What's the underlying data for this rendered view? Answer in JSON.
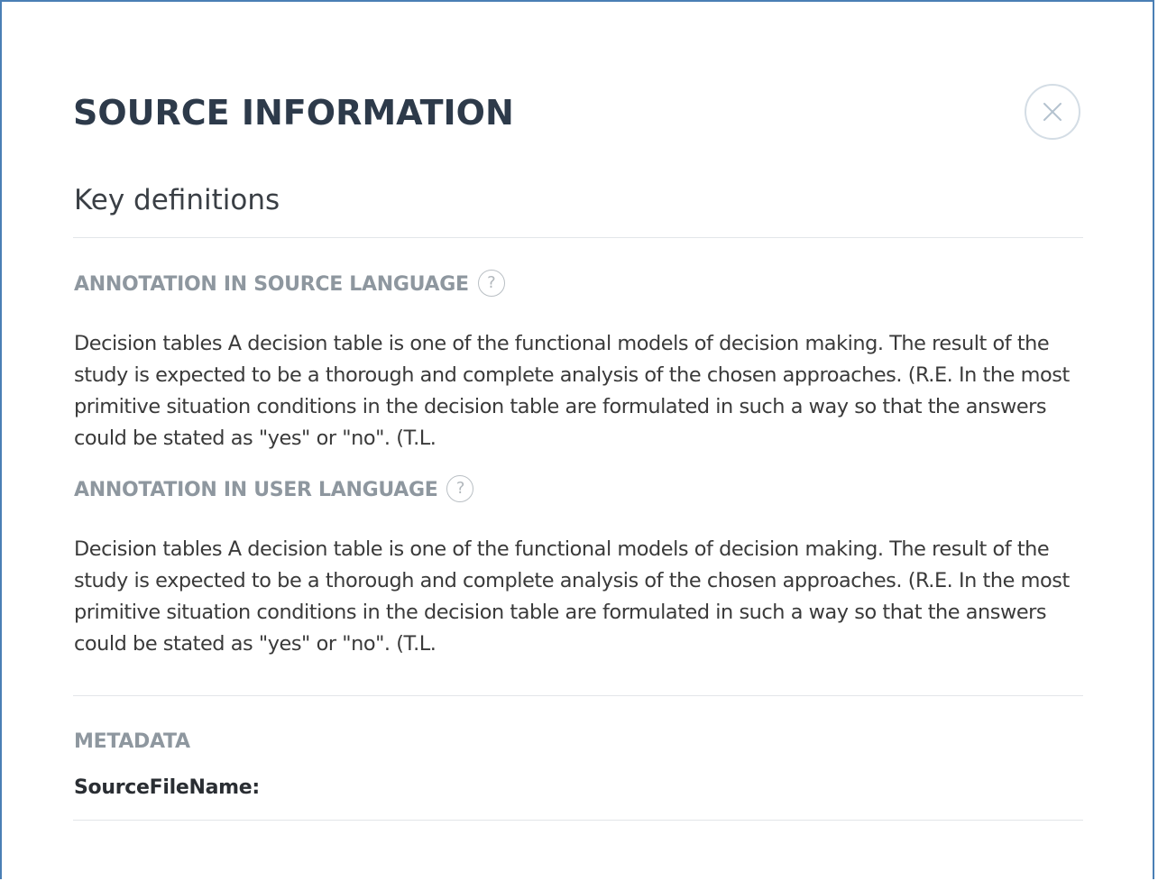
{
  "modal": {
    "title": "SOURCE INFORMATION",
    "close_icon": "close-icon",
    "subtitle": "Key definitions",
    "annotation_source": {
      "label": "ANNOTATION IN SOURCE LANGUAGE",
      "help_symbol": "?",
      "text": "Decision tables A decision table is one of the functional models of decision making. The result of the study is expected to be a thorough and complete analysis of the chosen approaches. (R.E. In the most primitive situation conditions in the decision table are formulated in such a way so that the answers could be stated as \"yes\" or \"no\". (T.L."
    },
    "annotation_user": {
      "label": "ANNOTATION IN USER LANGUAGE",
      "help_symbol": "?",
      "text": "Decision tables A decision table is one of the functional models of decision making. The result of the study is expected to be a thorough and complete analysis of the chosen approaches. (R.E. In the most primitive situation conditions in the decision table are formulated in such a way so that the answers could be stated as \"yes\" or \"no\". (T.L."
    },
    "metadata": {
      "label": "METADATA",
      "source_file_name_key": "SourceFileName:"
    }
  },
  "colors": {
    "frame_border": "#4a7fb5",
    "title": "#2d3a4a",
    "section_label": "#8e979f",
    "body_text": "#3a3a3a",
    "divider": "#e3e6e9"
  }
}
